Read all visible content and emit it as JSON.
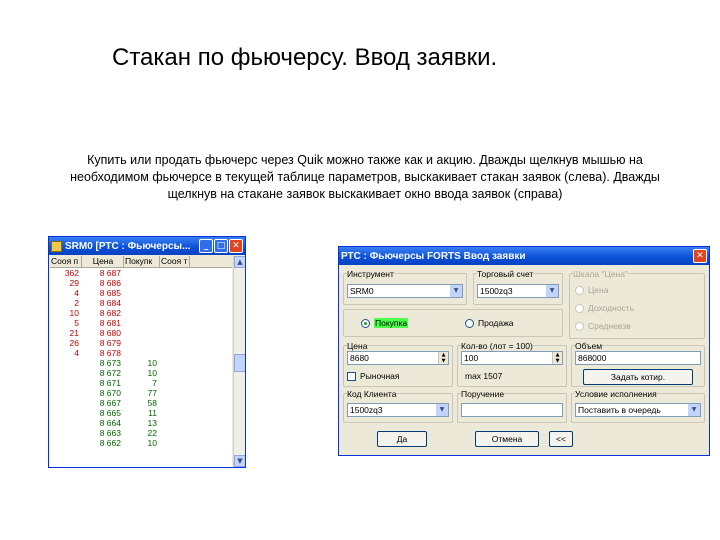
{
  "slide": {
    "title": "Стакан по фьючерсу. Ввод заявки.",
    "text": "Купить или продать фьючерс через Quik можно также как и акцию. Дважды щелкнув мышью на необходимом фьючерсе в текущей таблице параметров, выскакивает стакан заявок (слева). Дважды щелкнув на стакане заявок выскакивает окно ввода заявок (справа)"
  },
  "orderbook": {
    "title": "SRM0 [РТС : Фьючерсы...",
    "columns": [
      "Сооя п",
      "Цена",
      "Покупк",
      "Сооя т"
    ],
    "sell_rows": [
      {
        "sell": "362",
        "price": "8 687",
        "buy": ""
      },
      {
        "sell": "29",
        "price": "8 686",
        "buy": ""
      },
      {
        "sell": "4",
        "price": "8 685",
        "buy": ""
      },
      {
        "sell": "2",
        "price": "8 684",
        "buy": ""
      },
      {
        "sell": "10",
        "price": "8 682",
        "buy": ""
      },
      {
        "sell": "5",
        "price": "8 681",
        "buy": ""
      },
      {
        "sell": "21",
        "price": "8 680",
        "buy": ""
      },
      {
        "sell": "26",
        "price": "8 679",
        "buy": ""
      },
      {
        "sell": "4",
        "price": "8 678",
        "buy": ""
      }
    ],
    "buy_rows": [
      {
        "sell": "",
        "price": "8 673",
        "buy": "10"
      },
      {
        "sell": "",
        "price": "8 672",
        "buy": "10"
      },
      {
        "sell": "",
        "price": "8 671",
        "buy": "7"
      },
      {
        "sell": "",
        "price": "8 670",
        "buy": "77"
      },
      {
        "sell": "",
        "price": "8 667",
        "buy": "58"
      },
      {
        "sell": "",
        "price": "8 665",
        "buy": "11"
      },
      {
        "sell": "",
        "price": "8 664",
        "buy": "13"
      },
      {
        "sell": "",
        "price": "8 663",
        "buy": "22"
      },
      {
        "sell": "",
        "price": "8 662",
        "buy": "10"
      }
    ]
  },
  "order_form": {
    "title": "РТС : Фьючерсы FORTS Ввод заявки",
    "instrument_label": "Инструмент",
    "instrument_value": "SRM0",
    "account_label": "Торговый счет",
    "account_value": "1500zq3",
    "type_label": "Шкала \"Цена\"",
    "radio_price": "Цена",
    "radio_yield": "Доходность",
    "radio_avg": "Средневзв",
    "buy_label": "Покупка",
    "sell_label": "Продажа",
    "price_label": "Цена",
    "price_value": "8680",
    "qty_label": "Кол-во (лот = 100)",
    "qty_value": "100",
    "volume_label": "Объем",
    "volume_value": "868000",
    "market_label": "Рыночная",
    "max_label": "max 1507",
    "stop_label": "Задать котир.",
    "client_label": "Код Клиента",
    "client_value": "1500zq3",
    "instruction_label": "Поручение",
    "condition_label": "Условие исполнения",
    "condition_value": "Поставить в очередь",
    "ok_label": "Да",
    "cancel_label": "Отмена",
    "more_label": "<<"
  }
}
